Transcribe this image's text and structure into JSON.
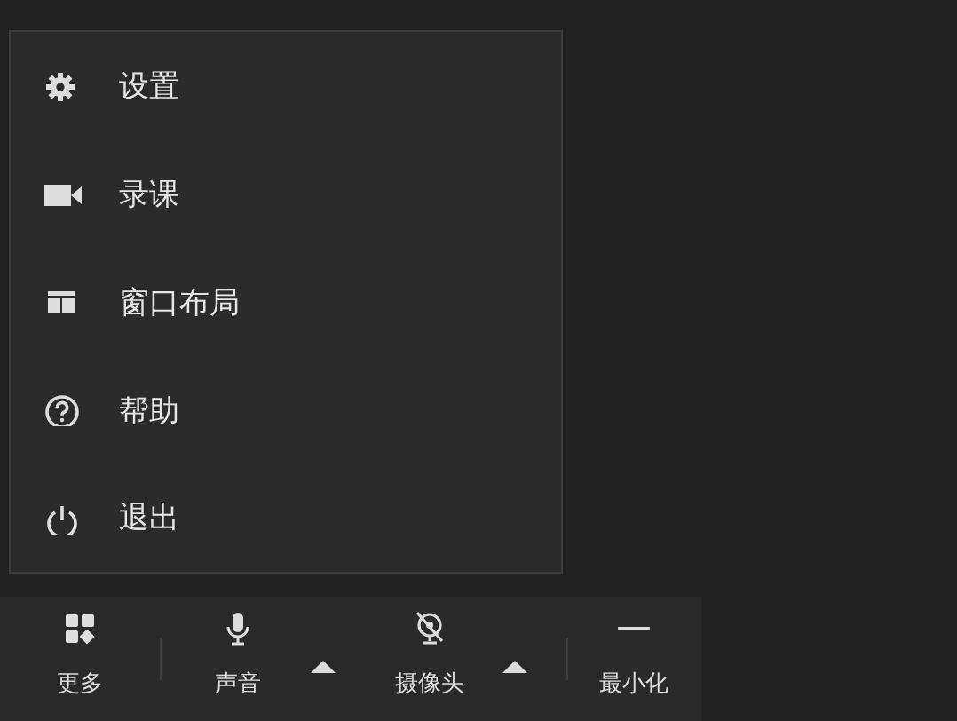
{
  "menu": {
    "items": [
      {
        "label": "设置"
      },
      {
        "label": "录课"
      },
      {
        "label": "窗口布局"
      },
      {
        "label": "帮助"
      },
      {
        "label": "退出"
      }
    ]
  },
  "toolbar": {
    "buttons": [
      {
        "label": "更多",
        "kind": "more",
        "has_menu": false
      },
      {
        "label": "声音",
        "kind": "mic",
        "muted": false,
        "has_menu": true
      },
      {
        "label": "摄像头",
        "kind": "camera",
        "muted": true,
        "has_menu": true
      },
      {
        "label": "最小化",
        "kind": "minimize",
        "has_menu": false
      }
    ]
  }
}
